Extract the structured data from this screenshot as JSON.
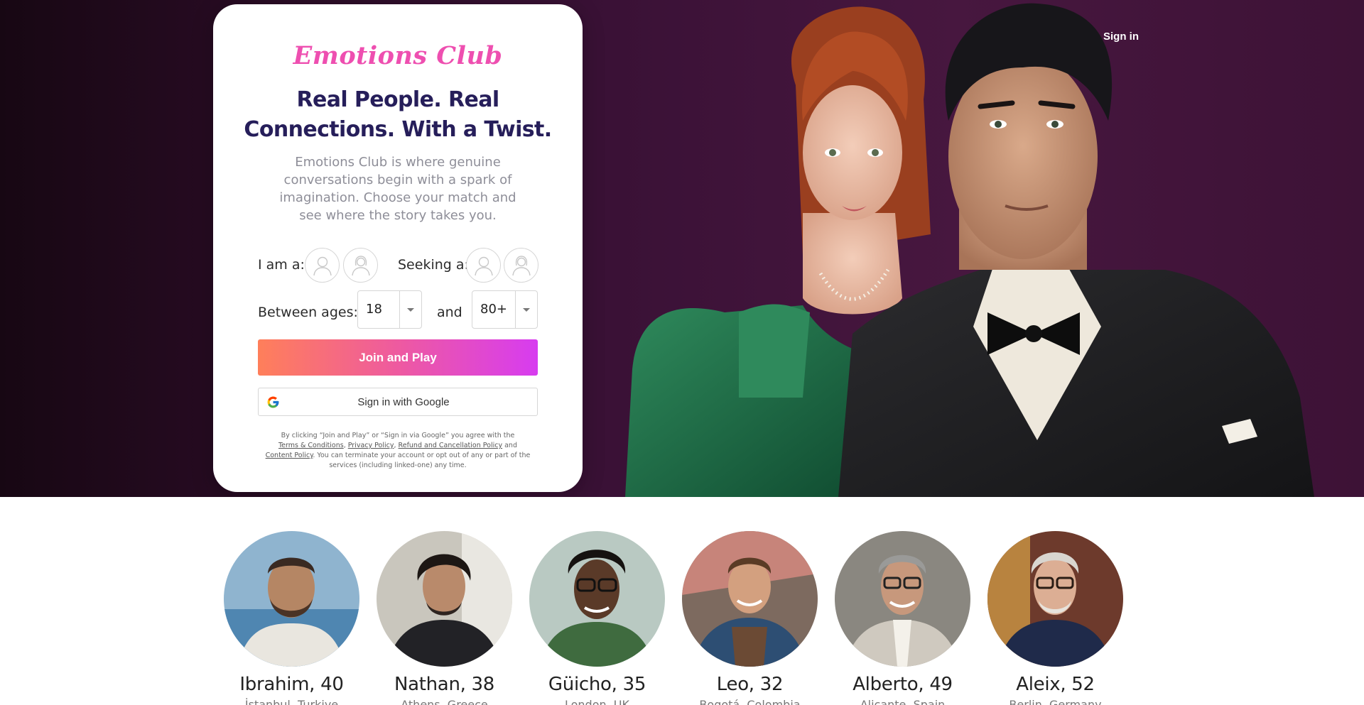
{
  "header": {
    "signin_label": "Sign in"
  },
  "card": {
    "logo": "Emotions Club",
    "headline": "Real People. Real Connections. With a Twist.",
    "subtext": "Emotions Club is where genuine conversations begin with a spark of imagination. Choose your match and see where the story takes you.",
    "i_am_label": "I am a:",
    "seeking_label": "Seeking a:",
    "ages_label": "Between ages:",
    "and_label": "and",
    "age_min": "18",
    "age_max": "80+",
    "join_label": "Join and Play",
    "google_label": "Sign in with Google",
    "legal": {
      "intro": "By clicking “Join and Play” or “Sign in via Google” you agree with the",
      "terms": "Terms & Conditions",
      "sep1": ", ",
      "privacy": "Privacy Policy",
      "sep2": ", ",
      "refund": "Refund and Cancellation Policy",
      "sep3": " and",
      "content": "Content Policy",
      "outro": ". You can terminate your account or opt out of any or part of the services (including linked-one) any time."
    }
  },
  "profiles": [
    {
      "name": "Ibrahim, 40",
      "location": "İstanbul, Turkiye"
    },
    {
      "name": "Nathan, 38",
      "location": "Athens, Greece"
    },
    {
      "name": "Güicho, 35",
      "location": "London, UK"
    },
    {
      "name": "Leo, 32",
      "location": "Bogotá, Colombia"
    },
    {
      "name": "Alberto, 49",
      "location": "Alicante, Spain"
    },
    {
      "name": "Aleix, 52",
      "location": "Berlin, Germany"
    }
  ],
  "colors": {
    "brand_pink": "#ee4fb0",
    "headline_navy": "#261e5a",
    "join_gradient_start": "#ff7f5a",
    "join_gradient_end": "#d73cf0",
    "hero_bg": "#3a1136"
  }
}
